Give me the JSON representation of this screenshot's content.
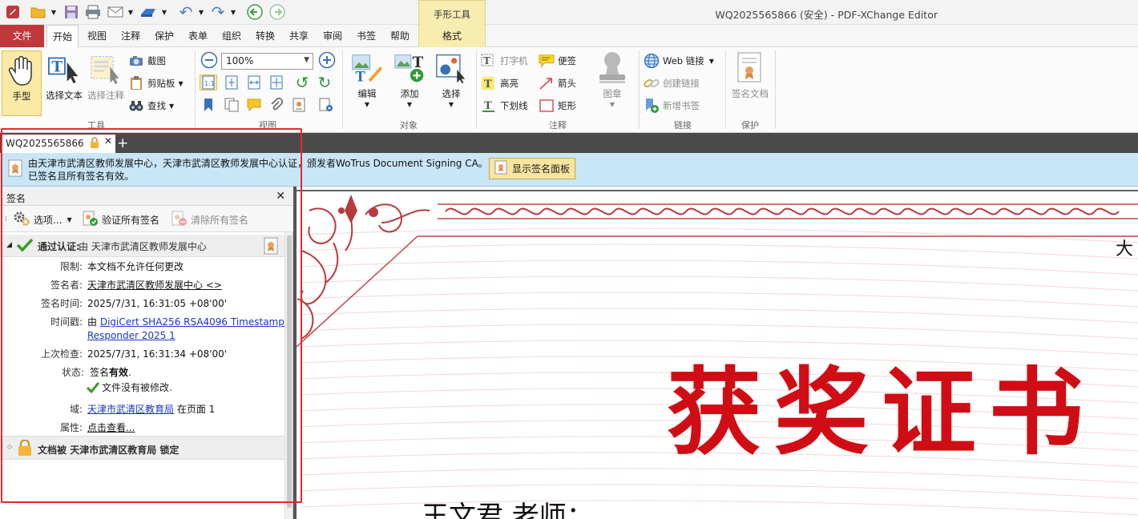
{
  "window": {
    "title": "WQ2025565866 (安全) - PDF-XChange Editor",
    "context_tool_label": "手形工具"
  },
  "menu": {
    "items": [
      "文件",
      "开始",
      "视图",
      "注释",
      "保护",
      "表单",
      "组织",
      "转换",
      "共享",
      "审阅",
      "书签",
      "帮助"
    ],
    "context_tab": "格式"
  },
  "ribbon": {
    "tools": {
      "hand": "手型",
      "select_text": "选择文本",
      "select_annot": "选择注释",
      "snapshot": "截图",
      "clipboard": "剪贴板",
      "find": "查找",
      "group": "工具"
    },
    "view": {
      "zoom": "100%",
      "group": "视图"
    },
    "objects": {
      "edit": "编辑",
      "add": "添加",
      "select": "选择",
      "group": "对象"
    },
    "annot": {
      "typewriter": "打字机",
      "note": "便签",
      "highlight": "高亮",
      "arrow": "箭头",
      "underline": "下划线",
      "rect": "矩形",
      "stamp": "图章",
      "group": "注释"
    },
    "links": {
      "web": "Web 链接",
      "create": "创建链接",
      "bookmark": "新增书签",
      "group": "链接"
    },
    "protect": {
      "sign": "签名文档",
      "group": "保护"
    }
  },
  "tab": {
    "name": "WQ2025565866"
  },
  "infobar": {
    "line1": "由天津市武清区教师发展中心，天津市武清区教师发展中心认证，颁发者WoTrus Document Signing CA。",
    "line2": "已签名且所有签名有效。",
    "button": "显示签名面板"
  },
  "sigpanel": {
    "title": "签名",
    "toolbar": {
      "options": "选项...",
      "verify_all": "验证所有签名",
      "clear_all": "清除所有签名"
    },
    "node_label": "通过认证:",
    "node_value": "由 天津市武清区教师发展中心",
    "rows": {
      "restriction": {
        "k": "限制:",
        "v": "本文档不允许任何更改"
      },
      "signer": {
        "k": "签名者:",
        "v": "天津市武清区教师发展中心 <>"
      },
      "sign_time": {
        "k": "签名时间:",
        "v": "2025/7/31, 16:31:05 +08'00'"
      },
      "timestamp": {
        "k": "时间戳:",
        "prefix": "由 ",
        "v1": "DigiCert SHA256 RSA4096 Timestamp",
        "v2": "Responder 2025 1"
      },
      "last_check": {
        "k": "上次检查:",
        "v": "2025/7/31, 16:31:34 +08'00'"
      },
      "status": {
        "k": "状态:",
        "v1a": "签名",
        "v1b": "有效",
        "v1c": ".",
        "v2": "文件没有被修改."
      },
      "field": {
        "k": "域:",
        "v": "天津市武清区教育局",
        "suffix": " 在页面 1"
      },
      "props": {
        "k": "属性:",
        "v": "点击查看..."
      }
    },
    "lock": {
      "a": "文档被",
      "b": " 天津市武清区教育局 锁定"
    }
  },
  "document": {
    "title": "获奖证书",
    "name_line": "王文君 老师：",
    "corner": "大"
  },
  "colors": {
    "accent": "#c0383c",
    "cert_red": "#d00d14",
    "info_bg": "#c9e6f7",
    "highlight": "#fbe9a6"
  }
}
